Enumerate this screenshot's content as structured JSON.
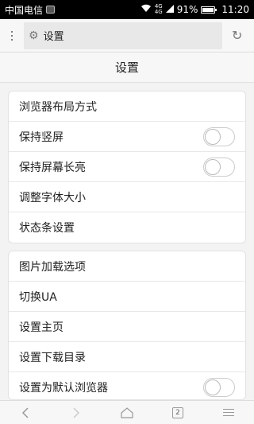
{
  "status_bar": {
    "carrier": "中国电信",
    "network_top": "4G",
    "network_bottom": "4G",
    "battery_percent": "91%",
    "time": "11:20"
  },
  "url_bar": {
    "address": "设置"
  },
  "header": {
    "title": "设置"
  },
  "settings": {
    "group1": [
      {
        "label": "浏览器布局方式"
      },
      {
        "label": "保持竖屏",
        "toggle": false
      },
      {
        "label": "保持屏幕长亮",
        "toggle": false
      },
      {
        "label": "调整字体大小"
      },
      {
        "label": "状态条设置"
      }
    ],
    "group2": [
      {
        "label": "图片加载选项"
      },
      {
        "label": "切换UA"
      },
      {
        "label": "设置主页"
      },
      {
        "label": "设置下载目录"
      },
      {
        "label": "设置为默认浏览器",
        "toggle": false
      }
    ]
  },
  "bottom_bar": {
    "tab_count": "2"
  },
  "icons": {
    "back": "back-icon",
    "forward": "forward-icon",
    "home": "home-icon",
    "tabs": "tabs-icon",
    "menu": "menu-icon",
    "gear": "gear-icon",
    "reload": "reload-icon"
  }
}
